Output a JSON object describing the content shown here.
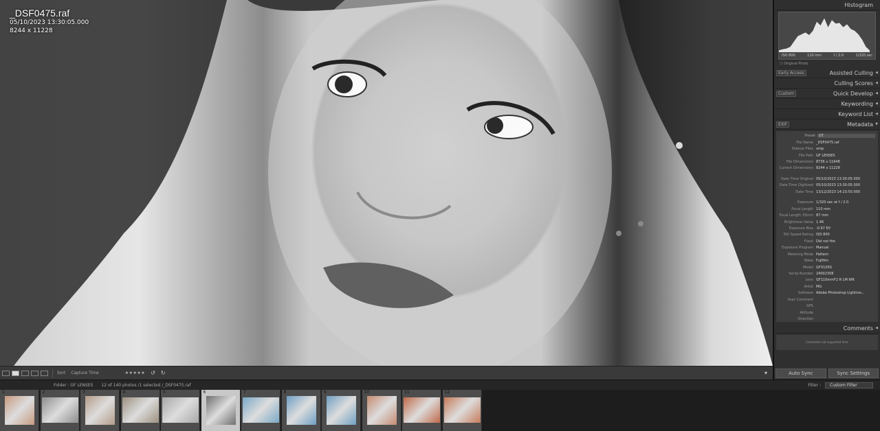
{
  "photo": {
    "filename": "_DSF0475.raf",
    "datetime": "05/10/2023 13:30:05.000",
    "dimensions": "8244 x 11228"
  },
  "toolbar": {
    "sort_label": "Sort",
    "sort_value": "Capture Time",
    "stars": "★★★★★"
  },
  "panels": {
    "histogram": "Histogram",
    "assisted_culling": "Assisted Culling",
    "early_access": "Early Access",
    "culling_scores": "Culling Scores",
    "quick_develop": "Quick Develop",
    "quick_develop_preset": "Custom",
    "keywording": "Keywording",
    "keyword_list": "Keyword List",
    "metadata": "Metadata",
    "metadata_mode": "EXIF",
    "comments": "Comments",
    "comments_note": "Comments not supported here",
    "auto_sync": "Auto Sync",
    "sync_settings": "Sync Settings"
  },
  "histogram": {
    "iso": "ISO 800",
    "focal": "110 mm",
    "aperture": "f / 2.0",
    "shutter": "1/320 sec",
    "original_photo": "Original Photo",
    "levels": [
      0.05,
      0.08,
      0.1,
      0.15,
      0.3,
      0.45,
      0.5,
      0.55,
      0.48,
      0.6,
      0.85,
      0.75,
      0.95,
      0.7,
      0.9,
      0.8,
      0.82,
      0.7,
      0.78,
      0.65,
      0.6,
      0.5,
      0.35,
      0.15,
      0.05
    ]
  },
  "metadata": {
    "preset_label": "Preset",
    "preset_value": "GT",
    "rows": [
      {
        "k": "File Name",
        "v": "_DSF0475.raf"
      },
      {
        "k": "Sidecar Files",
        "v": "xmp"
      },
      {
        "k": "File Path",
        "v": "GF LENSES"
      },
      {
        "k": "File Dimensions",
        "v": "8736 x 11648"
      },
      {
        "k": "Current Dimensions",
        "v": "8244 x 11228"
      },
      {
        "k": "",
        "v": ""
      },
      {
        "k": "Date Time Original",
        "v": "05/10/2023 13:30:05.000"
      },
      {
        "k": "Date Time Digitized",
        "v": "05/10/2023 13:30:05.000"
      },
      {
        "k": "Date Time",
        "v": "13/12/2023 14:23:50.000"
      },
      {
        "k": "",
        "v": ""
      },
      {
        "k": "Exposure",
        "v": "1/320 sec at f / 2.0"
      },
      {
        "k": "Focal Length",
        "v": "110 mm"
      },
      {
        "k": "Focal Length 35mm",
        "v": "87 mm"
      },
      {
        "k": "Brightness Value",
        "v": "1.46"
      },
      {
        "k": "Exposure Bias",
        "v": "-0.67 EV"
      },
      {
        "k": "ISO Speed Rating",
        "v": "ISO 800"
      },
      {
        "k": "Flash",
        "v": "Did not fire"
      },
      {
        "k": "Exposure Program",
        "v": "Manual"
      },
      {
        "k": "Metering Mode",
        "v": "Pattern"
      },
      {
        "k": "Make",
        "v": "Fujifilm"
      },
      {
        "k": "Model",
        "v": "GFX100S"
      },
      {
        "k": "Serial Number",
        "v": "24002308"
      },
      {
        "k": "Lens",
        "v": "GF110mmF2 R LM WR"
      },
      {
        "k": "Artist",
        "v": "MG"
      },
      {
        "k": "Software",
        "v": "Adobe Photoshop Lightroo..."
      },
      {
        "k": "User Comment",
        "v": ""
      },
      {
        "k": "GPS",
        "v": ""
      },
      {
        "k": "Altitude",
        "v": ""
      },
      {
        "k": "Direction",
        "v": ""
      }
    ]
  },
  "filmstrip_bar": {
    "folder": "Folder : GF LENSES",
    "count": "12 of 140 photos /1 selected /_DSF0475.raf",
    "filter_label": "Filter :",
    "filter_value": "Custom Filter"
  },
  "filmstrip": [
    {
      "n": "1",
      "tone": "#c79a80"
    },
    {
      "n": "2",
      "tone": "#8e8e8e"
    },
    {
      "n": "3",
      "tone": "#b39b88"
    },
    {
      "n": "4",
      "tone": "#9c9080"
    },
    {
      "n": "5",
      "tone": "#a8a8a8"
    },
    {
      "n": "6",
      "tone": "#6e6e6e"
    },
    {
      "n": "7",
      "tone": "#7aa8c6"
    },
    {
      "n": "8",
      "tone": "#6e9ec4"
    },
    {
      "n": "9",
      "tone": "#6f9fc2"
    },
    {
      "n": "10",
      "tone": "#c48a70"
    },
    {
      "n": "11",
      "tone": "#c06a4a"
    },
    {
      "n": "12",
      "tone": "#c67b5a"
    }
  ]
}
